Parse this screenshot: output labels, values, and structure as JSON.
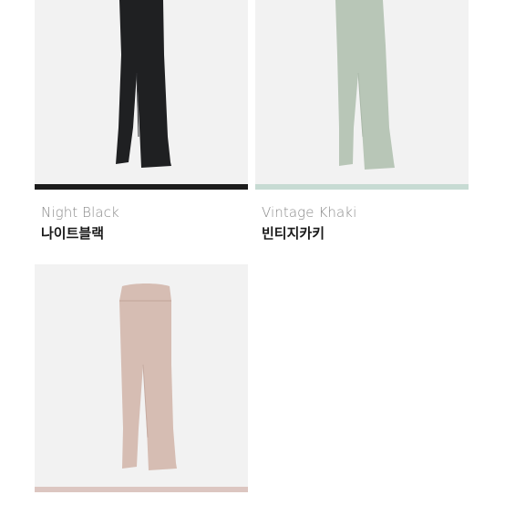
{
  "products": [
    {
      "name_en": "Night Black",
      "name_ko": "나이트블랙",
      "color": "#1e1f21",
      "bar_color": "#1c1c1c",
      "image": "black-flare-leggings"
    },
    {
      "name_en": "Vintage Khaki",
      "name_ko": "빈티지카키",
      "color": "#b9c7b8",
      "bar_color": "#c7dbd3",
      "image": "khaki-flare-leggings"
    },
    {
      "name_en": "",
      "name_ko": "",
      "color": "#d8beb5",
      "bar_color": "#dcc6c1",
      "image": "pink-flare-leggings"
    }
  ]
}
